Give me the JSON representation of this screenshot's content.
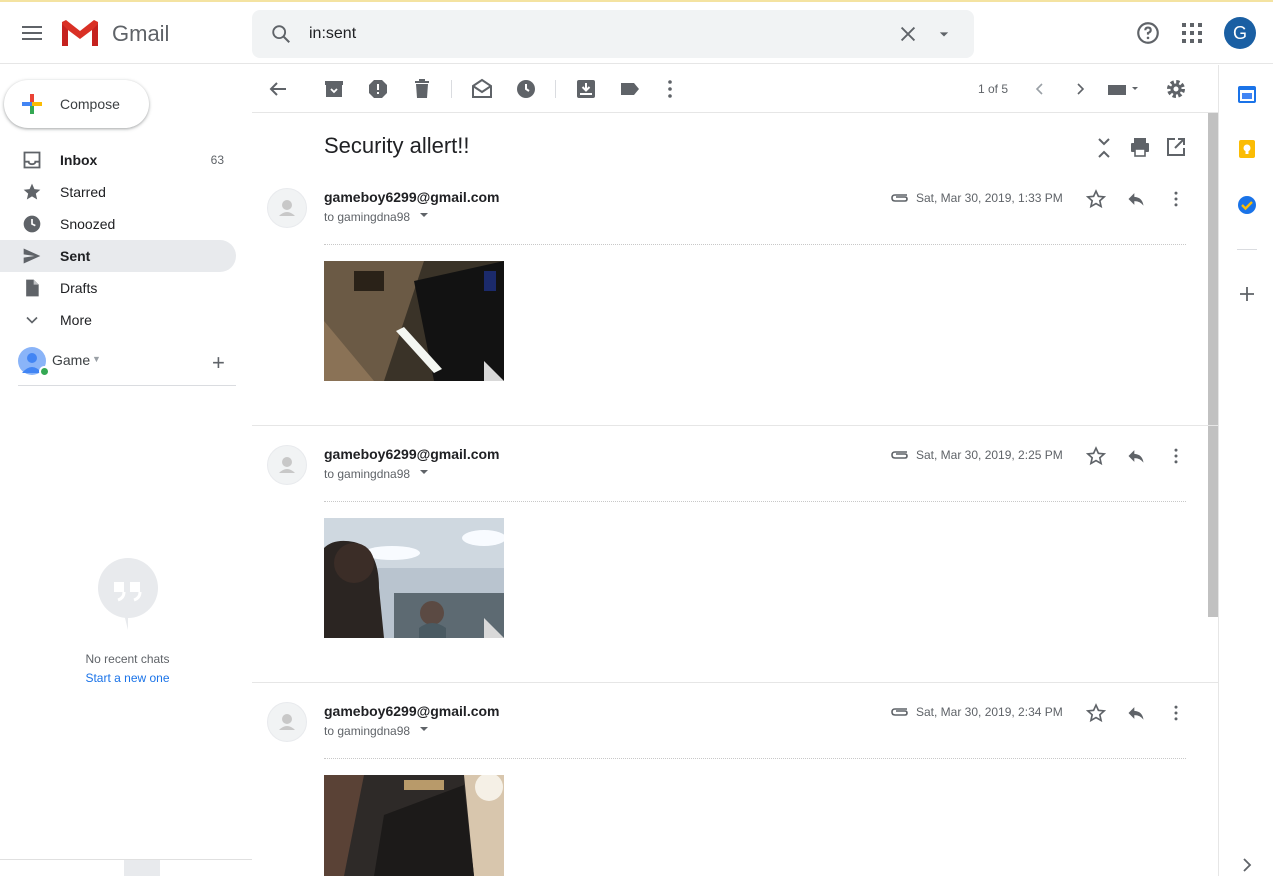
{
  "app": {
    "name": "Gmail"
  },
  "search": {
    "query": "in:sent"
  },
  "account": {
    "initial": "G"
  },
  "compose": {
    "label": "Compose"
  },
  "nav": [
    {
      "label": "Inbox",
      "count": "63",
      "icon": "inbox-icon",
      "bold": true
    },
    {
      "label": "Starred",
      "count": "",
      "icon": "star-icon"
    },
    {
      "label": "Snoozed",
      "count": "",
      "icon": "clock-icon"
    },
    {
      "label": "Sent",
      "count": "",
      "icon": "send-icon",
      "active": true
    },
    {
      "label": "Drafts",
      "count": "",
      "icon": "draft-icon"
    },
    {
      "label": "More",
      "count": "",
      "icon": "chevron-down-icon"
    }
  ],
  "hangouts": {
    "name": "Game",
    "no_chats": "No recent chats",
    "start_new": "Start a new one"
  },
  "toolbar": {
    "pager": "1 of 5"
  },
  "thread": {
    "subject": "Security allert!!",
    "messages": [
      {
        "from": "gameboy6299@gmail.com",
        "to": "to gamingdna98",
        "date": "Sat, Mar 30, 2019, 1:33 PM"
      },
      {
        "from": "gameboy6299@gmail.com",
        "to": "to gamingdna98",
        "date": "Sat, Mar 30, 2019, 2:25 PM"
      },
      {
        "from": "gameboy6299@gmail.com",
        "to": "to gamingdna98",
        "date": "Sat, Mar 30, 2019, 2:34 PM"
      }
    ]
  },
  "colors": {
    "accent": "#1a73e8",
    "active_nav": "#e8eaed",
    "avatar": "#1a5fa3"
  }
}
